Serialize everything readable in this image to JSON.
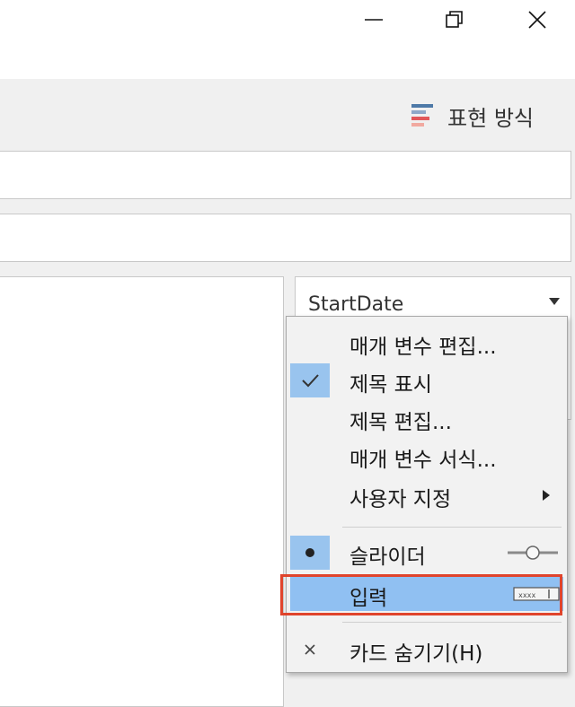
{
  "window": {
    "minimize_icon": "minimize-icon",
    "restore_icon": "restore-icon",
    "close_icon": "close-icon"
  },
  "toolbar": {
    "show_me_label": "표현 방식",
    "show_me_icon": "show-me-icon",
    "show_me_colors": [
      "#4e79a7",
      "#8fa8c8",
      "#e15759",
      "#f1a9a0"
    ]
  },
  "card": {
    "title": "StartDate"
  },
  "context_menu": {
    "items": [
      {
        "label": "매개 변수 편집...",
        "checked": false
      },
      {
        "label": "제목 표시",
        "checked": true
      },
      {
        "label": "제목 편집...",
        "checked": false
      },
      {
        "label": "매개 변수 서식...",
        "checked": false
      },
      {
        "label": "사용자 지정",
        "submenu": true
      }
    ],
    "mode_items": [
      {
        "label": "슬라이더",
        "selected": true,
        "icon": "slider-icon"
      },
      {
        "label": "입력",
        "selected": false,
        "highlighted": true,
        "icon": "type-in-icon"
      }
    ],
    "hide_item": {
      "label": "카드 숨기기(H)",
      "icon": "close-icon"
    }
  },
  "colors": {
    "highlight": "#90c0f2",
    "annotation": "#e0442c"
  }
}
